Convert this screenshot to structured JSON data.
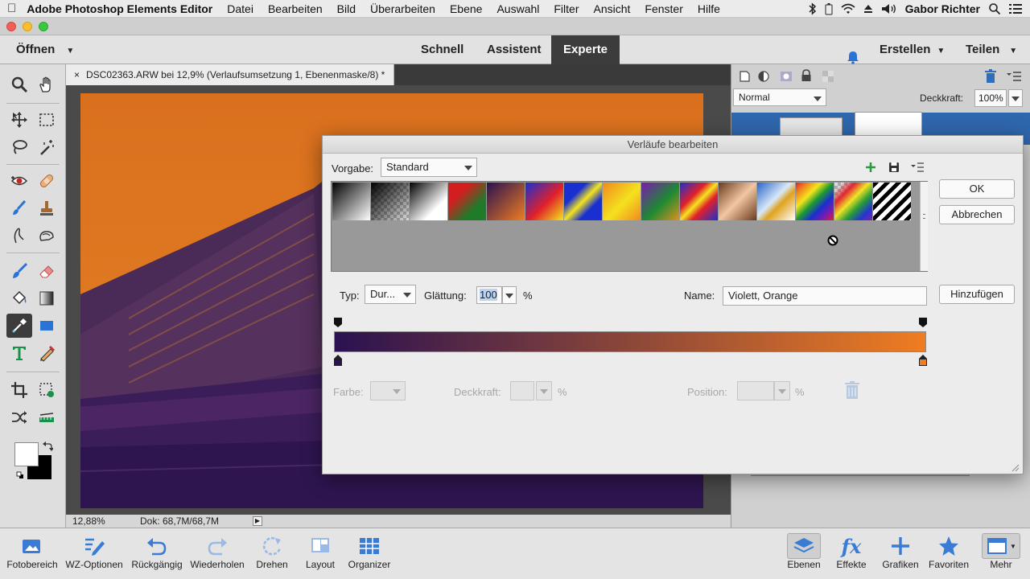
{
  "menubar": {
    "app_name": "Adobe Photoshop Elements Editor",
    "items": [
      "Datei",
      "Bearbeiten",
      "Bild",
      "Überarbeiten",
      "Ebene",
      "Auswahl",
      "Filter",
      "Ansicht",
      "Fenster",
      "Hilfe"
    ],
    "user": "Gabor Richter"
  },
  "topbar": {
    "open_label": "Öffnen",
    "tabs": [
      "Schnell",
      "Assistent",
      "Experte"
    ],
    "active_tab": "Experte",
    "create_label": "Erstellen",
    "share_label": "Teilen"
  },
  "document": {
    "tab_title": "DSC02363.ARW bei 12,9% (Verlaufsumsetzung 1, Ebenenmaske/8) *",
    "zoom": "12,88%",
    "doc_size": "Dok: 68,7M/68,7M"
  },
  "layers_panel": {
    "blend_mode": "Normal",
    "opacity_label": "Deckkraft:",
    "opacity_value": "100%"
  },
  "dialog": {
    "title": "Verläufe bearbeiten",
    "preset_label": "Vorgabe:",
    "preset_value": "Standard",
    "ok_label": "OK",
    "cancel_label": "Abbrechen",
    "add_label": "Hinzufügen",
    "type_label": "Typ:",
    "type_value": "Dur...",
    "smoothness_label": "Glättung:",
    "smoothness_value": "100",
    "percent": "%",
    "name_label": "Name:",
    "name_value": "Violett, Orange",
    "color_label": "Farbe:",
    "opacity_label": "Deckkraft:",
    "position_label": "Position:",
    "gradient_colors": [
      "#2a1150",
      "#ef7d22"
    ]
  },
  "bottombar": {
    "items": [
      "Fotobereich",
      "WZ-Optionen",
      "Rückgängig",
      "Wiederholen",
      "Drehen",
      "Layout",
      "Organizer",
      "Ebenen",
      "Effekte",
      "Grafiken",
      "Favoriten",
      "Mehr"
    ]
  }
}
